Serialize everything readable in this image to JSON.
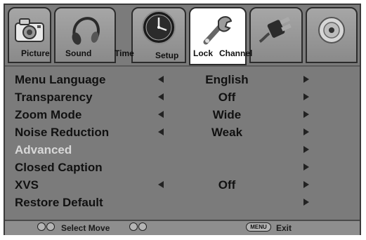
{
  "tabs": [
    {
      "id": "picture",
      "label": "Picture",
      "icon": "camera-icon",
      "active": false
    },
    {
      "id": "sound",
      "label": "Sound",
      "icon": "headphones-icon",
      "active": false
    },
    {
      "id": "time",
      "label": "Time",
      "icon": "clock-icon",
      "active": false
    },
    {
      "id": "setup",
      "label": "Setup",
      "icon": "wrench-icon",
      "active": true
    },
    {
      "id": "lock",
      "label": "Lock",
      "icon": "plug-icon",
      "active": false
    },
    {
      "id": "channel",
      "label": "Channel",
      "icon": "satellite-dish-icon",
      "active": false
    }
  ],
  "menu": {
    "items": [
      {
        "label": "Menu Language",
        "value": "English",
        "has_left_arrow": true,
        "has_right_arrow": true,
        "enabled": true
      },
      {
        "label": "Transparency",
        "value": "Off",
        "has_left_arrow": true,
        "has_right_arrow": true,
        "enabled": true
      },
      {
        "label": "Zoom Mode",
        "value": "Wide",
        "has_left_arrow": true,
        "has_right_arrow": true,
        "enabled": true
      },
      {
        "label": "Noise Reduction",
        "value": "Weak",
        "has_left_arrow": true,
        "has_right_arrow": true,
        "enabled": true
      },
      {
        "label": "Advanced",
        "value": "",
        "has_left_arrow": false,
        "has_right_arrow": true,
        "enabled": false
      },
      {
        "label": "Closed Caption",
        "value": "",
        "has_left_arrow": false,
        "has_right_arrow": true,
        "enabled": true
      },
      {
        "label": "XVS",
        "value": "Off",
        "has_left_arrow": true,
        "has_right_arrow": true,
        "enabled": true
      },
      {
        "label": "Restore Default",
        "value": "",
        "has_left_arrow": false,
        "has_right_arrow": true,
        "enabled": true
      }
    ]
  },
  "footer": {
    "select_move_label": "Select Move",
    "menu_key_label": "MENU",
    "exit_label": "Exit"
  },
  "colors": {
    "panel": "#7b7b7b",
    "active_tab": "#ffffff",
    "disabled_text": "#d8d8d8",
    "text": "#111111"
  }
}
